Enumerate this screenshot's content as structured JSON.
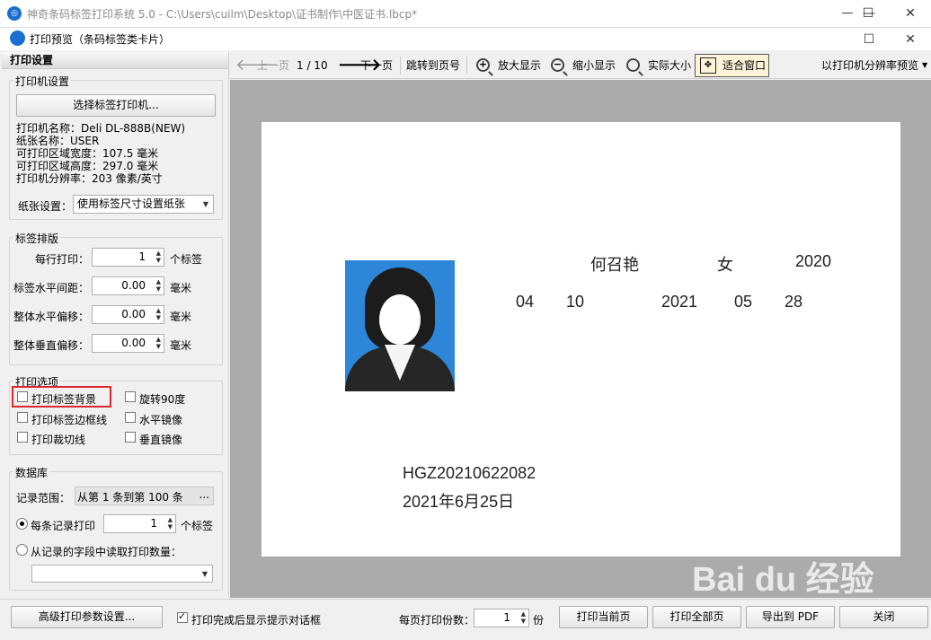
{
  "window": {
    "title": "神奇条码标签打印系统 5.0 - C:\\Users\\cuilm\\Desktop\\证书制作\\中医证书.lbcp*",
    "minimize": "—",
    "maximize": "☐",
    "close": "✕"
  },
  "dialog": {
    "title": "打印预览（条码标签类卡片）",
    "maximize": "☐",
    "close": "✕"
  },
  "left_panel": {
    "header": "打印设置",
    "printer_group": {
      "title": "打印机设置",
      "select_printer_button": "选择标签打印机...",
      "info": [
        "打印机名称：Deli DL-888B(NEW)",
        "纸张名称：USER",
        "可打印区域宽度：107.5 毫米",
        "可打印区域高度：297.0 毫米",
        "打印机分辨率：203 像素/英寸"
      ],
      "paper_label": "纸张设置：",
      "paper_value": "使用标签尺寸设置纸张"
    },
    "layout_group": {
      "title": "标签排版",
      "rows": [
        {
          "label": "每行打印：",
          "value": "1",
          "unit": "个标签"
        },
        {
          "label": "标签水平间距：",
          "value": "0.00",
          "unit": "毫米"
        },
        {
          "label": "整体水平偏移：",
          "value": "0.00",
          "unit": "毫米"
        },
        {
          "label": "整体垂直偏移：",
          "value": "0.00",
          "unit": "毫米"
        }
      ]
    },
    "options_group": {
      "title": "打印选项",
      "print_background": "打印标签背景",
      "rotate_90": "旋转90度",
      "print_border": "打印标签边框线",
      "mirror_h": "水平镜像",
      "print_cut_line": "打印裁切线",
      "mirror_v": "垂直镜像"
    },
    "database_group": {
      "title": "数据库",
      "range_label": "记录范围：",
      "range_value": "从第 1 条到第 100 条",
      "range_button": "...",
      "per_record_label": "每条记录打印",
      "per_record_value": "1",
      "per_record_unit": "个标签",
      "from_field_label": "从记录的字段中读取打印数量：",
      "field_value": ""
    }
  },
  "toolbar": {
    "prev": "上一页",
    "page_info": "1 / 10",
    "next": "下一页",
    "goto": "跳转到页号",
    "zoom_in": "放大显示",
    "zoom_out": "缩小显示",
    "actual_size": "实际大小",
    "fit_window": "适合窗口",
    "printer_res_preview": "以打印机分辨率预览"
  },
  "card": {
    "name": "何召艳",
    "gender": "女",
    "year": "2020",
    "month": "04",
    "day": "10",
    "year2": "2021",
    "month2": "05",
    "day2": "28",
    "cert_no": "HGZ20210622082",
    "issue_date": "2021年6月25日"
  },
  "bottom_bar": {
    "advanced_button": "高级打印参数设置...",
    "show_dialog_label": "打印完成后显示提示对话框",
    "copies_label": "每页打印份数：",
    "copies_value": "1",
    "copies_unit": "份",
    "print_current": "打印当前页",
    "print_all": "打印全部页",
    "export_pdf": "导出到 PDF",
    "close": "关闭"
  },
  "watermark": "Bai du 经验",
  "colors": {
    "accent_blue": "#1a6fd0",
    "highlight_red": "#d9272e",
    "preview_bg": "#ababab",
    "photo_bg": "#2d86d8"
  }
}
